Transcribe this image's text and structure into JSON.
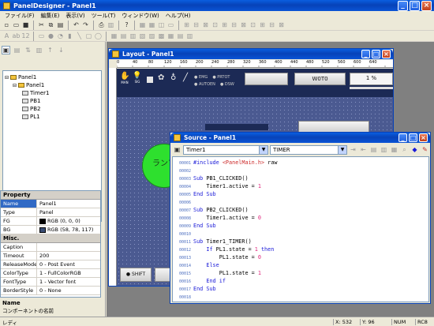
{
  "app": {
    "title": "PanelDesigner - Panel1",
    "menu": [
      "ファイル(F)",
      "編集(E)",
      "表示(V)",
      "ツール(T)",
      "ウィンドウ(W)",
      "ヘルプ(H)"
    ]
  },
  "tree": {
    "root": "Panel1",
    "child": "Panel1",
    "items": [
      "Timer1",
      "PB1",
      "PB2",
      "PL1"
    ]
  },
  "properties": {
    "header": "Property",
    "rows": [
      {
        "key": "Name",
        "value": "Panel1"
      },
      {
        "key": "Type",
        "value": "Panel"
      },
      {
        "key": "FG",
        "value": "RGB (0, 0, 0)",
        "swatch": "#000000"
      },
      {
        "key": "BG",
        "value": "RGB (58, 78, 117)",
        "swatch": "#3a4e75"
      }
    ],
    "misc_header": "Misc.",
    "misc_rows": [
      {
        "key": "Caption",
        "value": ""
      },
      {
        "key": "Timeout",
        "value": "200"
      },
      {
        "key": "ReleaseMode",
        "value": "0 - Post Event"
      },
      {
        "key": "ColorType",
        "value": "1 - FullColorRGB"
      },
      {
        "key": "FontType",
        "value": "1 - Vector font"
      },
      {
        "key": "BorderStyle",
        "value": "0 - None"
      }
    ],
    "desc_title": "Name",
    "desc_text": "コンポーネントの名前"
  },
  "layout_window": {
    "title": "Layout - Panel1",
    "ruler": [
      "0",
      "40",
      "80",
      "120",
      "160",
      "200",
      "240",
      "280",
      "320",
      "360",
      "400",
      "440",
      "480",
      "520",
      "560",
      "600",
      "640"
    ],
    "tool_labels": [
      "MAN",
      "SIG",
      "",
      "",
      ""
    ],
    "status_labels": [
      "EMG",
      "PRTOT",
      "AUTOEN",
      "DSW"
    ],
    "buttons": [
      "W0T0",
      "1 %"
    ],
    "lamp_text": "ランプ",
    "shift_label": "SHIFT"
  },
  "source_window": {
    "title": "Source - Panel1",
    "object_combo": "Timer1",
    "event_combo": "TIMER",
    "lines": [
      {
        "n": "00001",
        "t": "#include <PanelMain.h> raw"
      },
      {
        "n": "00002",
        "t": ""
      },
      {
        "n": "00003",
        "t": "Sub PB1_CLICKED()"
      },
      {
        "n": "00004",
        "t": "    Timer1.active = 1"
      },
      {
        "n": "00005",
        "t": "End Sub"
      },
      {
        "n": "00006",
        "t": ""
      },
      {
        "n": "00007",
        "t": "Sub PB2_CLICKED()"
      },
      {
        "n": "00008",
        "t": "    Timer1.active = 0"
      },
      {
        "n": "00009",
        "t": "End Sub"
      },
      {
        "n": "00010",
        "t": ""
      },
      {
        "n": "00011",
        "t": "Sub Timer1_TIMER()"
      },
      {
        "n": "00012",
        "t": "    If PL1.state = 1 then"
      },
      {
        "n": "00013",
        "t": "        PL1.state = 0"
      },
      {
        "n": "00014",
        "t": "    Else"
      },
      {
        "n": "00015",
        "t": "        PL1.state = 1"
      },
      {
        "n": "00016",
        "t": "    End if"
      },
      {
        "n": "00017",
        "t": "End Sub"
      },
      {
        "n": "00018",
        "t": ""
      }
    ]
  },
  "status": {
    "left": "レディ",
    "x": "X:   532",
    "y": "Y:   96",
    "num": "NUM",
    "rc": "RC8"
  },
  "colors": {
    "lamp": "#2ee02e",
    "canvas": "#4b5a91",
    "titlebar": "#0a54d6"
  }
}
